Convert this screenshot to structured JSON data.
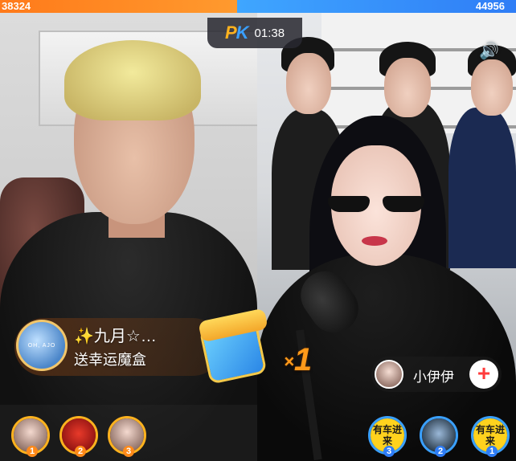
{
  "pk": {
    "left_score": "38324",
    "right_score": "44956",
    "logo_p": "P",
    "logo_k": "K",
    "timer": "01:38",
    "colors": {
      "left": "#ff8a1a",
      "right": "#3a8ef6"
    }
  },
  "sound": {
    "icon": "speaker-icon",
    "glyph": "🔊"
  },
  "activity": {
    "avatar_text": "OH, AJO",
    "title": "✨九月☆…",
    "subtitle": "送幸运魔盒"
  },
  "gift": {
    "icon": "gift-box-icon",
    "multiplier_x": "×",
    "multiplier_n": "1"
  },
  "anchor": {
    "name": "小伊伊",
    "follow_glyph": "+"
  },
  "contributors": {
    "left": [
      {
        "rank": "1",
        "avatar": "avatar-photo"
      },
      {
        "rank": "2",
        "avatar": "avatar-red-poster"
      },
      {
        "rank": "3",
        "avatar": "avatar-photo"
      }
    ],
    "right": [
      {
        "rank": "3",
        "avatar": "avatar-text",
        "text": "有车进来"
      },
      {
        "rank": "2",
        "avatar": "avatar-photo"
      },
      {
        "rank": "1",
        "avatar": "avatar-text",
        "text": "有车进来"
      }
    ]
  }
}
